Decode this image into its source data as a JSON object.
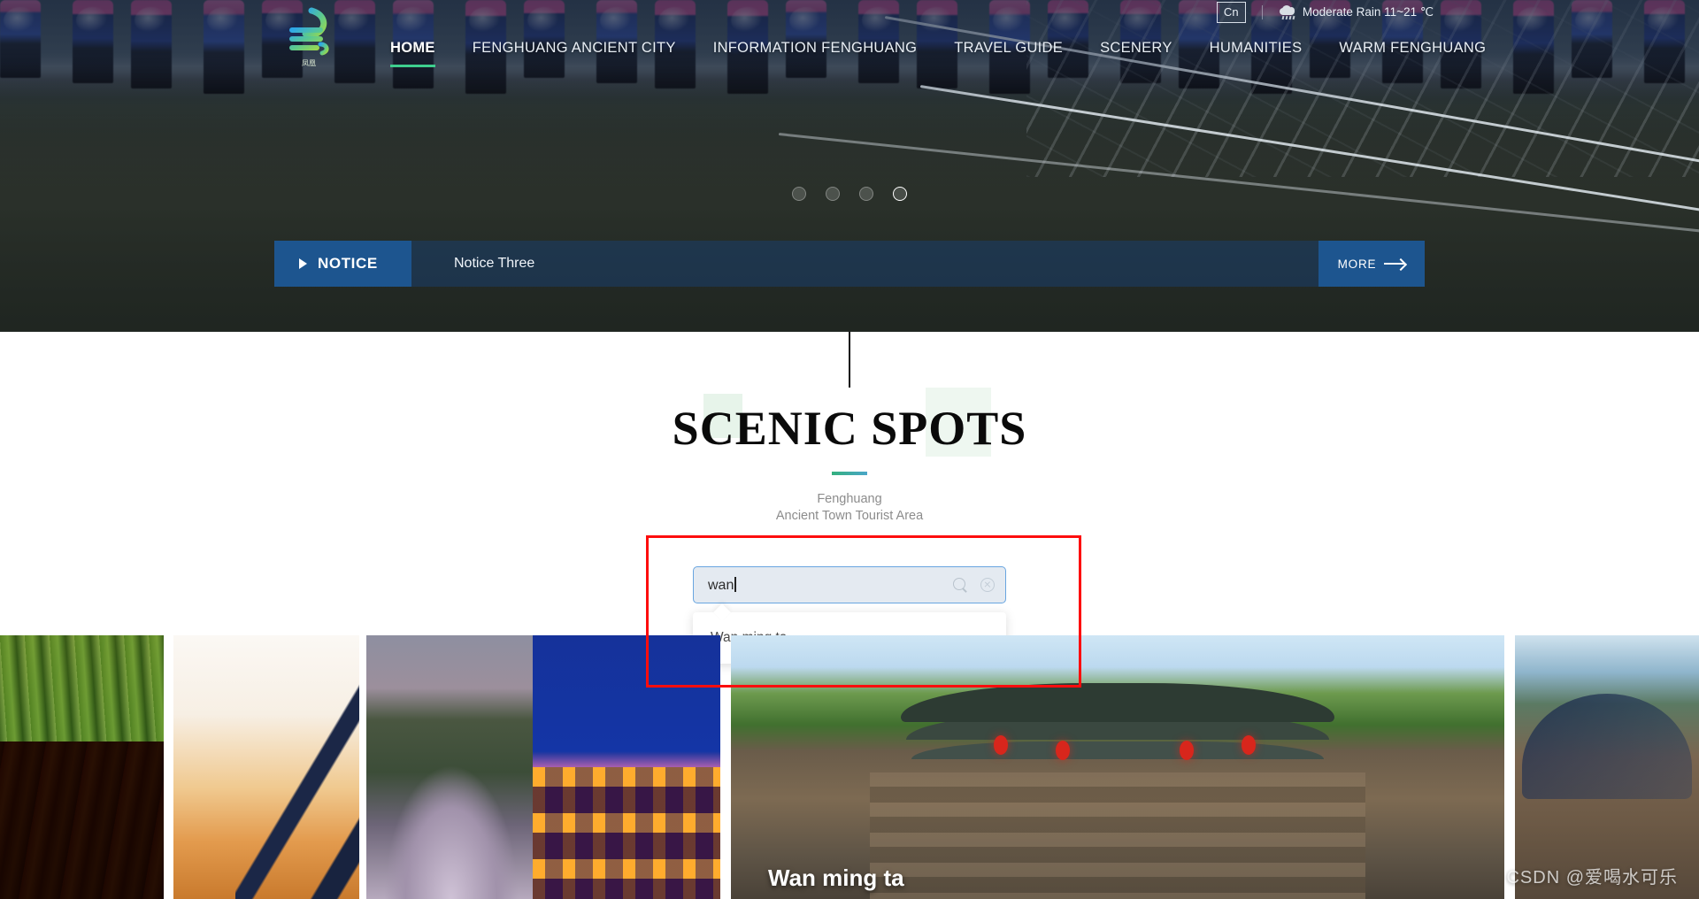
{
  "topbar": {
    "lang_label": "Cn",
    "weather_icon": "cloud-rain-icon",
    "weather_text": "Moderate Rain 11~21 ℃"
  },
  "header": {
    "logo_alt": "Fenghuang phoenix logo",
    "nav_items": [
      {
        "label": "HOME",
        "active": true
      },
      {
        "label": "FENGHUANG ANCIENT CITY",
        "active": false
      },
      {
        "label": "INFORMATION FENGHUANG",
        "active": false
      },
      {
        "label": "TRAVEL GUIDE",
        "active": false
      },
      {
        "label": "SCENERY",
        "active": false
      },
      {
        "label": "HUMANITIES",
        "active": false
      },
      {
        "label": "WARM FENGHUANG",
        "active": false
      }
    ]
  },
  "carousel": {
    "dots": [
      "1",
      "2",
      "3",
      "4"
    ],
    "active_index": 3
  },
  "notice": {
    "label": "NOTICE",
    "current_item": "Notice Three",
    "more_label": "MORE"
  },
  "scenic": {
    "title": "SCENIC SPOTS",
    "subtitle_line1": "Fenghuang",
    "subtitle_line2": "Ancient Town Tourist Area"
  },
  "search": {
    "value": "wan",
    "placeholder": "",
    "search_icon": "magnifier-icon",
    "clear_icon": "clear-circle-icon",
    "suggestions": [
      "Wan ming ta"
    ]
  },
  "gallery": {
    "thumbs": [
      {
        "name": "red-chili-peppers"
      },
      {
        "name": "pagoda-at-dawn"
      },
      {
        "name": "rainbow-bridge"
      },
      {
        "name": "night-hotel-facade"
      }
    ],
    "feature": {
      "name": "wan-ming-ta-tower",
      "caption": "Wan ming ta"
    },
    "trailing": {
      "name": "ancient-street"
    }
  },
  "watermark": "CSDN @爱喝水可乐",
  "colors": {
    "accent_green": "#3ecf8e",
    "notice_blue": "#1d558f",
    "annotation_red": "#fd0d0d",
    "input_border": "#68a5e0",
    "input_fill": "#e4eaf1"
  }
}
